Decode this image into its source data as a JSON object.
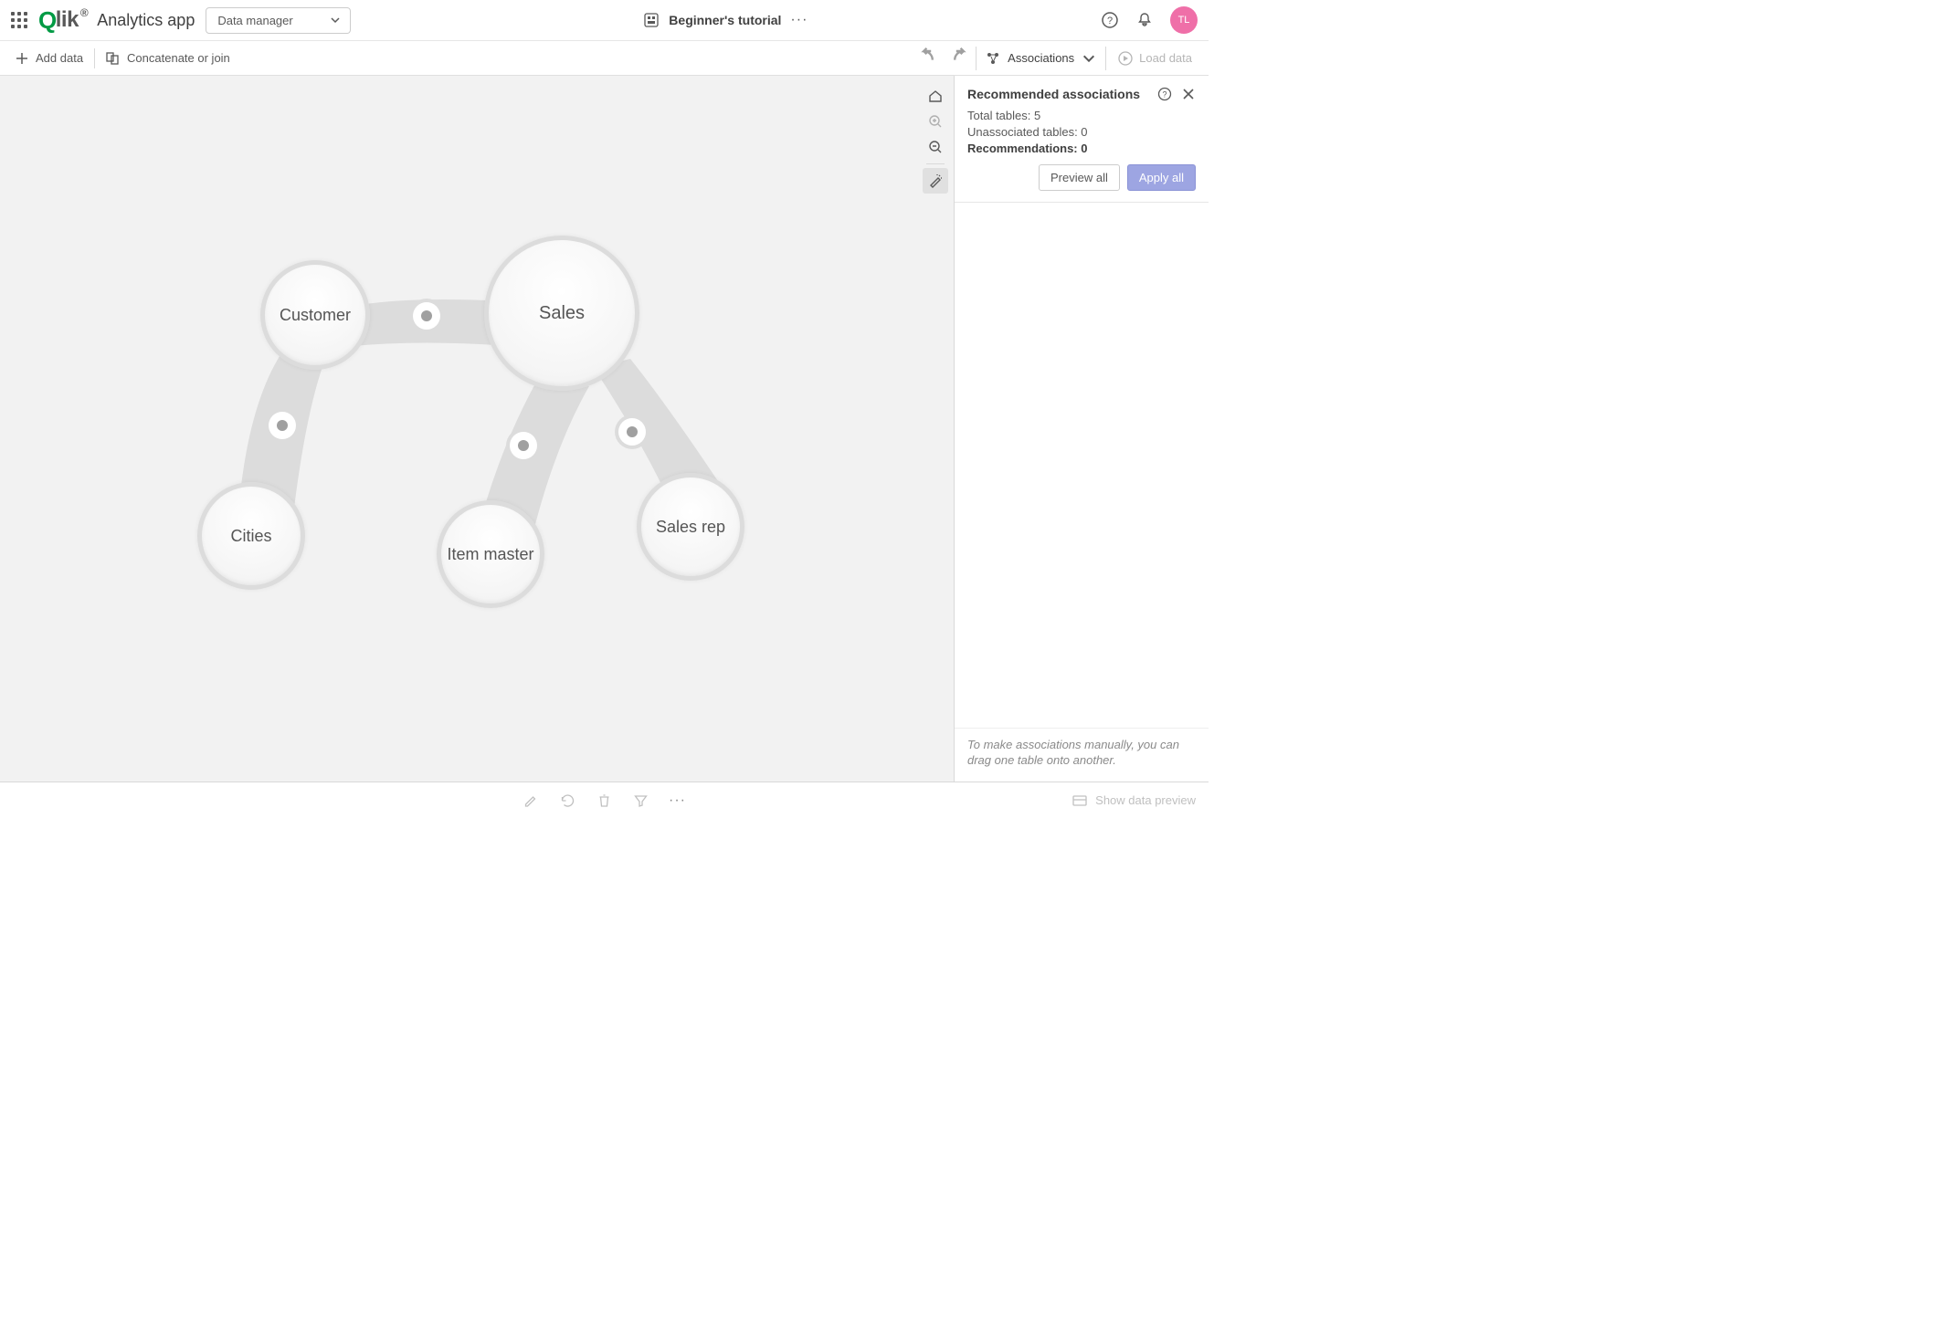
{
  "header": {
    "app_name": "Analytics app",
    "dropdown_label": "Data manager",
    "sheet_title": "Beginner's tutorial",
    "avatar_initials": "TL"
  },
  "toolbar": {
    "add_data": "Add data",
    "concat_or_join": "Concatenate or join",
    "mode_label": "Associations",
    "load_data": "Load data"
  },
  "bubbles": {
    "customer": "Customer",
    "sales": "Sales",
    "cities": "Cities",
    "item_master": "Item master",
    "sales_rep": "Sales rep"
  },
  "panel": {
    "title": "Recommended associations",
    "total_label": "Total tables: ",
    "total_value": "5",
    "unassoc_label": "Unassociated tables: ",
    "unassoc_value": "0",
    "rec_label": "Recommendations: ",
    "rec_value": "0",
    "preview_all": "Preview all",
    "apply_all": "Apply all",
    "hint": "To make associations manually, you can drag one table onto another."
  },
  "bottom": {
    "show_preview": "Show data preview"
  }
}
